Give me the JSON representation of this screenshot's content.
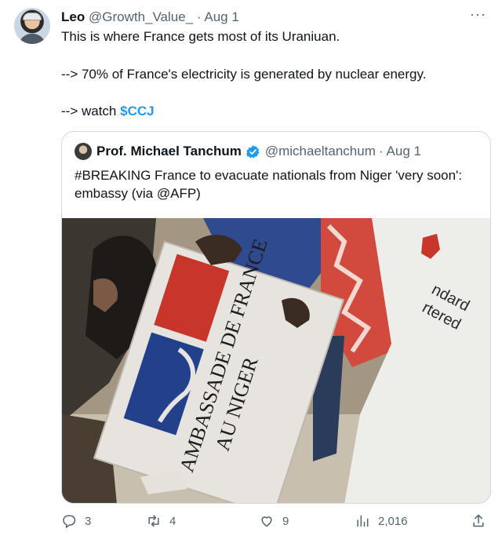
{
  "tweet": {
    "author_name": "Leo",
    "author_handle": "@Growth_Value_",
    "separator": "·",
    "date": "Aug 1",
    "line1": "This is where France gets most of its Uraniuan.",
    "line2": "--> 70% of France's electricity is generated by nuclear energy.",
    "line3_prefix": "--> watch ",
    "cashtag": "$CCJ",
    "more_label": "···"
  },
  "quoted": {
    "author_name": "Prof. Michael Tanchum",
    "author_handle": "@michaeltanchum",
    "separator": "·",
    "date": "Aug 1",
    "text": "#BREAKING France to evacuate nationals from Niger 'very soon': embassy (via @AFP)",
    "image": {
      "sign_line1": "AMBASSADE DE FRANCE",
      "sign_line2": "AU NIGER",
      "shirt_text1": "ndard",
      "shirt_text2": "rtered"
    }
  },
  "actions": {
    "replies": "3",
    "retweets": "4",
    "likes": "9",
    "views": "2,016"
  },
  "colors": {
    "accent": "#1d9bf0",
    "muted": "#536471",
    "text": "#0f1419",
    "border": "#cfd9de"
  }
}
